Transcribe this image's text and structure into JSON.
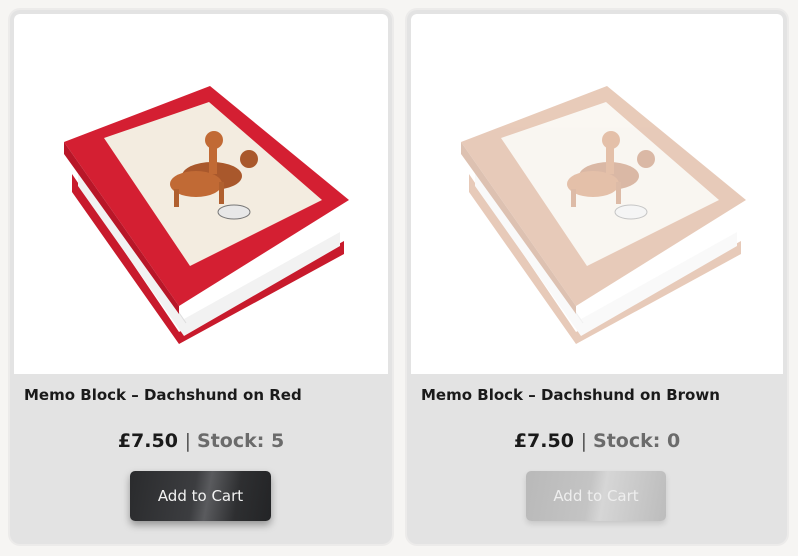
{
  "currency_symbol": "£",
  "separator": "|",
  "products": [
    {
      "title": "Memo Block – Dachshund on Red",
      "price": "£7.50",
      "stock_label": "Stock: 5",
      "button_label": "Add to Cart",
      "cover_color": "#d41f32",
      "in_stock": true
    },
    {
      "title": "Memo Block – Dachshund on Brown",
      "price": "£7.50",
      "stock_label": "Stock: 0",
      "button_label": "Add to Cart",
      "cover_color": "#c8835a",
      "in_stock": false
    }
  ]
}
